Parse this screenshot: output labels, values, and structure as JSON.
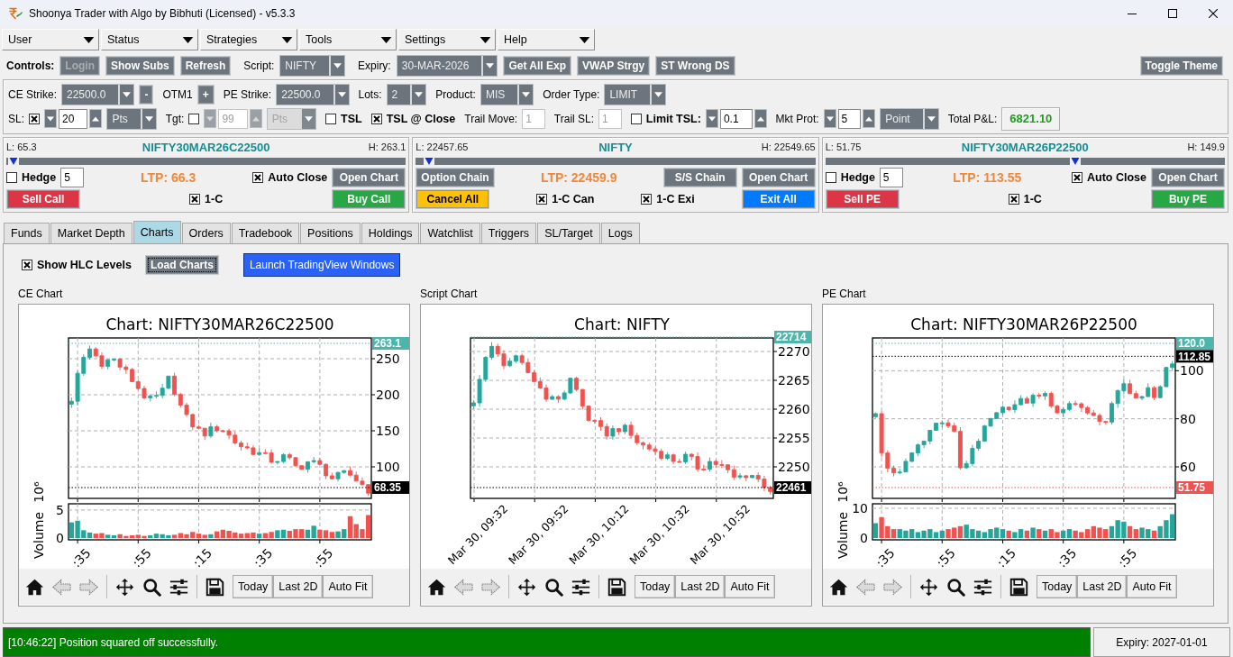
{
  "window": {
    "title": "Shoonya Trader with Algo by Bibhuti (Licensed) - v5.3.3"
  },
  "menus": [
    "User",
    "Status",
    "Strategies",
    "Tools",
    "Settings",
    "Help"
  ],
  "controls": {
    "items": [
      {
        "kind": "heading",
        "text": "Controls:"
      },
      {
        "kind": "button",
        "label": "Login",
        "color": "#6c757d",
        "disabled": true
      },
      {
        "kind": "button",
        "label": "Show Subs",
        "color": "#6c757d",
        "disabled": false
      },
      {
        "kind": "button",
        "label": "Refresh",
        "color": "#6c757d",
        "disabled": false
      },
      {
        "kind": "label",
        "text": "Script:"
      },
      {
        "kind": "combo",
        "value": "NIFTY",
        "disabled": false
      },
      {
        "kind": "label",
        "text": "Expiry:"
      },
      {
        "kind": "combo",
        "value": "30-MAR-2026",
        "disabled": false
      },
      {
        "kind": "button",
        "label": "Get All Exp",
        "color": "#6c757d",
        "disabled": false
      },
      {
        "kind": "button",
        "label": "VWAP Strgy",
        "color": "#6c757d",
        "disabled": false
      },
      {
        "kind": "button",
        "label": "ST Wrong DS",
        "color": "#6c757d",
        "disabled": false
      }
    ],
    "end_items": [
      {
        "kind": "button",
        "label": "Toggle Theme",
        "color": "#6c757d",
        "disabled": false
      }
    ]
  },
  "order_settings": {
    "strike_bar": {
      "items": [
        {
          "kind": "label",
          "text": "CE Strike:"
        },
        {
          "kind": "combo",
          "value": "22500.0",
          "disabled": false
        },
        {
          "kind": "button",
          "label": "-",
          "color": "#6c757d",
          "disabled": false
        },
        {
          "kind": "label",
          "text": "OTM1"
        },
        {
          "kind": "button",
          "label": "+",
          "color": "#6c757d",
          "disabled": false
        },
        {
          "kind": "label",
          "text": "PE Strike:"
        },
        {
          "kind": "combo",
          "value": "22500.0",
          "disabled": false
        },
        {
          "kind": "label",
          "text": "Lots:"
        },
        {
          "kind": "combo",
          "value": "2",
          "disabled": false
        },
        {
          "kind": "label",
          "text": "Product:"
        },
        {
          "kind": "combo",
          "value": "MIS",
          "disabled": false
        },
        {
          "kind": "label",
          "text": "Order Type:"
        },
        {
          "kind": "combo",
          "value": "LIMIT",
          "disabled": false
        }
      ]
    },
    "risk_bar": {
      "items": [
        {
          "kind": "label",
          "text": "SL:"
        },
        {
          "kind": "check",
          "checked": true
        },
        {
          "kind": "spin",
          "value": "20",
          "disabled": false
        },
        {
          "kind": "combo",
          "value": "Pts",
          "disabled": false
        },
        {
          "kind": "label",
          "text": "Tgt:"
        },
        {
          "kind": "check",
          "checked": false
        },
        {
          "kind": "spin",
          "value": "99",
          "disabled": true
        },
        {
          "kind": "combo",
          "value": "Pts",
          "disabled": true
        },
        {
          "kind": "check",
          "label": "TSL",
          "checked": false
        },
        {
          "kind": "check",
          "label": "TSL @ Close",
          "checked": true
        },
        {
          "kind": "label",
          "text": "Trail Move:"
        },
        {
          "kind": "entry",
          "value": "1",
          "disabled": true
        },
        {
          "kind": "label",
          "text": "Trail SL:"
        },
        {
          "kind": "entry",
          "value": "1",
          "disabled": true
        },
        {
          "kind": "check",
          "label": "Limit TSL:",
          "checked": false
        },
        {
          "kind": "spin",
          "value": "0.1",
          "disabled": false
        },
        {
          "kind": "label",
          "text": "Mkt Prot:"
        },
        {
          "kind": "spin",
          "value": "5",
          "disabled": false
        },
        {
          "kind": "combo",
          "value": "Point",
          "disabled": false
        },
        {
          "kind": "label",
          "text": "Total P&L:"
        },
        {
          "kind": "pnl",
          "value": "6821.10"
        }
      ]
    }
  },
  "panels": [
    {
      "low": "L: 65.3",
      "symbol": "NIFTY30MAR26C22500",
      "high": "H: 263.1",
      "level": 0.005,
      "upper": [
        [
          {
            "kind": "check",
            "label": "Hedge",
            "checked": false
          },
          {
            "kind": "entry",
            "value": "5",
            "disabled": false
          }
        ],
        [
          {
            "kind": "ltp",
            "text": "LTP: 66.3"
          }
        ],
        [
          {
            "kind": "check",
            "label": "Auto Close",
            "checked": true
          },
          {
            "kind": "button",
            "label": "Open Chart",
            "color": "#6c757d",
            "disabled": false
          }
        ]
      ],
      "lower": [
        [
          {
            "kind": "button",
            "label": "Sell Call",
            "color": "#dc3545",
            "disabled": false
          }
        ],
        [
          {
            "kind": "check",
            "label": "1-C",
            "checked": true
          }
        ],
        [
          {
            "kind": "button",
            "label": "Buy Call",
            "color": "#28a745",
            "disabled": false
          }
        ]
      ]
    },
    {
      "low": "L: 22457.65",
      "symbol": "NIFTY",
      "high": "H: 22549.65",
      "level": 0.02,
      "upper": [
        [
          {
            "kind": "button",
            "label": "Option Chain",
            "color": "#6c757d",
            "disabled": false
          }
        ],
        [
          {
            "kind": "ltp",
            "text": "LTP: 22459.9"
          }
        ],
        [
          {
            "kind": "button",
            "label": "S/S Chain",
            "color": "#6c757d",
            "disabled": false
          },
          {
            "kind": "button",
            "label": "Open Chart",
            "color": "#6c757d",
            "disabled": false
          }
        ]
      ],
      "lower": [
        [
          {
            "kind": "button",
            "label": "Cancel All",
            "color": "#ffc107",
            "disabled": false
          }
        ],
        [
          {
            "kind": "check",
            "label": "1-C Can",
            "checked": true
          }
        ],
        [
          {
            "kind": "check",
            "label": "1-C Exi",
            "checked": true
          }
        ],
        [
          {
            "kind": "button",
            "label": "Exit All",
            "color": "#007bff",
            "disabled": false
          }
        ]
      ]
    },
    {
      "low": "L: 51.75",
      "symbol": "NIFTY30MAR26P22500",
      "high": "H: 149.9",
      "level": 0.63,
      "upper": [
        [
          {
            "kind": "check",
            "label": "Hedge",
            "checked": false
          },
          {
            "kind": "entry",
            "value": "5",
            "disabled": false
          }
        ],
        [
          {
            "kind": "ltp",
            "text": "LTP: 113.55"
          }
        ],
        [
          {
            "kind": "check",
            "label": "Auto Close",
            "checked": true
          },
          {
            "kind": "button",
            "label": "Open Chart",
            "color": "#6c757d",
            "disabled": false
          }
        ]
      ],
      "lower": [
        [
          {
            "kind": "button",
            "label": "Sell PE",
            "color": "#dc3545",
            "disabled": false
          }
        ],
        [
          {
            "kind": "check",
            "label": "1-C",
            "checked": true
          }
        ],
        [
          {
            "kind": "button",
            "label": "Buy PE",
            "color": "#28a745",
            "disabled": false
          }
        ]
      ]
    }
  ],
  "tabs": [
    {
      "label": "Funds",
      "selected": false
    },
    {
      "label": "Market Depth",
      "selected": false
    },
    {
      "label": "Charts",
      "selected": true
    },
    {
      "label": "Orders",
      "selected": false
    },
    {
      "label": "Tradebook",
      "selected": false
    },
    {
      "label": "Positions",
      "selected": false
    },
    {
      "label": "Holdings",
      "selected": false
    },
    {
      "label": "Watchlist",
      "selected": false
    },
    {
      "label": "Triggers",
      "selected": false
    },
    {
      "label": "SL/Target",
      "selected": false
    },
    {
      "label": "Logs",
      "selected": false
    }
  ],
  "charts_tab": {
    "items": [
      {
        "kind": "check",
        "label": "Show HLC Levels",
        "checked": true
      },
      {
        "kind": "button",
        "label": "Load Charts",
        "color": "#6c757d",
        "disabled": false,
        "focused": true
      },
      {
        "kind": "plain_button",
        "label": "Launch TradingView Windows",
        "color": "#2a62f5",
        "disabled": false,
        "focused": false
      }
    ],
    "charts": [
      {
        "label": "CE Chart",
        "price": {
          "title": "Chart: NIFTY30MAR26C22500",
          "kind": "falling",
          "axis_labels": [
            "250",
            "200",
            "150",
            "100"
          ],
          "tags": [
            {
              "text": "263.1",
              "color": "#4db6ac"
            },
            {
              "text": "68.35",
              "color": "#000000"
            }
          ]
        },
        "volume": {
          "scale_label": "10⁶",
          "chart_data": {
            "type": "bar",
            "ylabel": "Volume",
            "grid": true,
            "ylim": [
              -0.3,
              6.1
            ],
            "yticks": [
              5,
              0
            ],
            "categories": [
              null,
              ":35",
              null,
              null,
              null,
              null,
              null,
              null,
              null,
              null,
              null,
              ":55",
              null,
              null,
              null,
              null,
              null,
              null,
              null,
              null,
              null,
              ":15",
              null,
              null,
              null,
              null,
              null,
              null,
              null,
              null,
              null,
              ":35",
              null,
              null,
              null,
              null,
              null,
              null,
              null,
              null,
              null,
              ":55",
              null,
              null,
              null,
              null,
              null,
              null,
              null,
              null
            ],
            "values": [
              2.8,
              3.1,
              1.4,
              1.0,
              0.8,
              0.9,
              0.6,
              0.5,
              0.7,
              0.4,
              0.5,
              0.6,
              0.4,
              0.5,
              0.8,
              0.7,
              0.5,
              0.6,
              0.9,
              0.7,
              1.1,
              0.8,
              0.6,
              0.7,
              1.2,
              1.5,
              1.3,
              1.0,
              0.8,
              0.9,
              1.0,
              0.8,
              0.9,
              1.1,
              1.4,
              1.5,
              1.3,
              1.6,
              1.6,
              1.5,
              2.2,
              1.5,
              1.4,
              1.1,
              1.2,
              1.6,
              3.9,
              2.5,
              1.6,
              4.1
            ]
          }
        },
        "toolbar_buttons": [
          "Today",
          "Last 2D",
          "Auto Fit"
        ]
      },
      {
        "label": "Script Chart",
        "price": {
          "title": "Chart: NIFTY",
          "kind": "falling",
          "axis_labels": [
            "2270",
            "2265",
            "2260",
            "2255",
            "2250"
          ],
          "tags": [
            {
              "text": "22714",
              "color": "#4db6ac"
            },
            {
              "text": "22461",
              "color": "#000000"
            }
          ],
          "time_labels": [
            "Mar 30, 09:32",
            "Mar 30, 09:52",
            "Mar 30, 10:12",
            "Mar 30, 10:32",
            "Mar 30, 10:52"
          ]
        },
        "toolbar_buttons": [
          "Today",
          "Last 2D",
          "Auto Fit"
        ]
      },
      {
        "label": "PE Chart",
        "price": {
          "title": "Chart: NIFTY30MAR26P22500",
          "kind": "rising",
          "axis_labels": [
            "100",
            "80",
            "60"
          ],
          "tags": [
            {
              "text": "120.0",
              "color": "#4db6ac"
            },
            {
              "text": "112.85",
              "color": "#000000"
            },
            {
              "text": "51.75",
              "color": "#ef5350"
            }
          ]
        },
        "volume": {
          "scale_label": "10⁶",
          "chart_data": {
            "type": "bar",
            "ylabel": "Volume",
            "grid": true,
            "ylim": [
              -0.6,
              11.5
            ],
            "yticks": [
              10,
              0
            ],
            "categories": [
              null,
              ":35",
              null,
              null,
              null,
              null,
              null,
              null,
              null,
              null,
              null,
              ":55",
              null,
              null,
              null,
              null,
              null,
              null,
              null,
              null,
              null,
              ":15",
              null,
              null,
              null,
              null,
              null,
              null,
              null,
              null,
              null,
              ":35",
              null,
              null,
              null,
              null,
              null,
              null,
              null,
              null,
              null,
              ":55",
              null,
              null,
              null,
              null,
              null,
              null,
              null,
              null
            ],
            "values": [
              5,
              7,
              4,
              3,
              3,
              2.5,
              3,
              2,
              2.5,
              3,
              2,
              2.5,
              3,
              3.5,
              4,
              4.5,
              3,
              2.5,
              2,
              3,
              3.5,
              3,
              2.5,
              2,
              3,
              2.5,
              3.5,
              3,
              2.5,
              3,
              2,
              2.5,
              3,
              2.5,
              2,
              3,
              4,
              3.5,
              3,
              4,
              6,
              5.5,
              4,
              3,
              3.5,
              3,
              2.5,
              4,
              6,
              8
            ]
          }
        },
        "toolbar_buttons": [
          "Today",
          "Last 2D",
          "Auto Fit"
        ]
      }
    ]
  },
  "status_bar": {
    "message": "[10:46:22] Position squared off successfully.",
    "expiry": "Expiry: 2027-01-01"
  }
}
